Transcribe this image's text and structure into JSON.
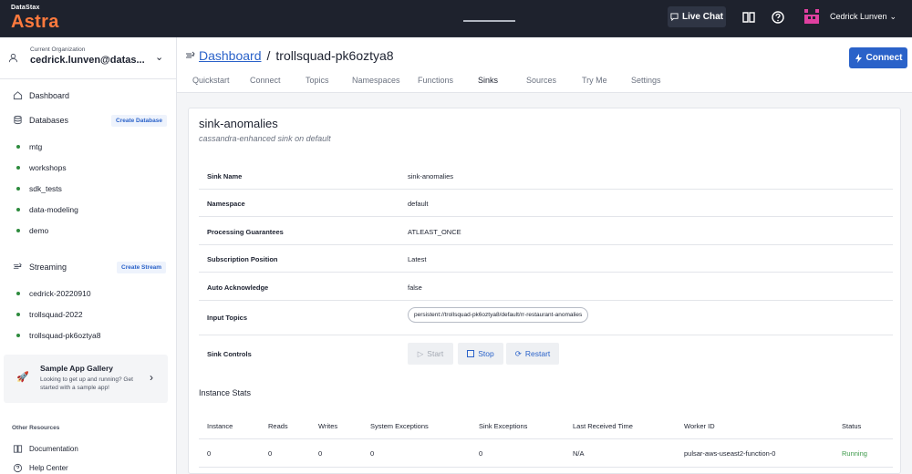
{
  "topbar": {
    "logo_small": "DataStax",
    "logo_big": "Astra",
    "live_chat": "Live Chat",
    "user_name": "Cedrick Lunven",
    "accent_color": "#ff7a3d"
  },
  "sidebar": {
    "org_label": "Current Organization",
    "org_value": "cedrick.lunven@datas...",
    "dashboard": "Dashboard",
    "databases": "Databases",
    "create_database": "Create Database",
    "database_items": [
      "mtg",
      "workshops",
      "sdk_tests",
      "data-modeling",
      "demo"
    ],
    "streaming": "Streaming",
    "create_stream": "Create Stream",
    "stream_items": [
      "cedrick-20220910",
      "trollsquad-2022",
      "trollsquad-pk6oztya8"
    ],
    "gallery_title": "Sample App Gallery",
    "gallery_text": "Looking to get up and running? Get started with a sample app!",
    "other_resources": "Other Resources",
    "documentation": "Documentation",
    "help_center": "Help Center"
  },
  "header": {
    "breadcrumb_link": "Dashboard",
    "separator": "/",
    "current": "trollsquad-pk6oztya8",
    "connect": "Connect"
  },
  "tabs": [
    "Quickstart",
    "Connect",
    "Topics",
    "Namespaces",
    "Functions",
    "Sinks",
    "Sources",
    "Try Me",
    "Settings"
  ],
  "active_tab": "Sinks",
  "sink": {
    "name": "sink-anomalies",
    "subtitle": "cassandra-enhanced sink on default",
    "details": [
      {
        "key": "Sink Name",
        "value": "sink-anomalies"
      },
      {
        "key": "Namespace",
        "value": "default"
      },
      {
        "key": "Processing Guarantees",
        "value": "ATLEAST_ONCE"
      },
      {
        "key": "Subscription Position",
        "value": "Latest"
      },
      {
        "key": "Auto Acknowledge",
        "value": "false"
      }
    ],
    "input_topics_label": "Input Topics",
    "input_topic": "persistent://trollsquad-pk6oztya8/default/rr-restaurant-anomalies",
    "controls_label": "Sink Controls",
    "start": "Start",
    "stop": "Stop",
    "restart": "Restart"
  },
  "stats": {
    "title": "Instance Stats",
    "headers": [
      "Instance",
      "Reads",
      "Writes",
      "System Exceptions",
      "Sink Exceptions",
      "Last Received Time",
      "Worker ID",
      "Status"
    ],
    "row": [
      "0",
      "0",
      "0",
      "0",
      "0",
      "N/A",
      "pulsar-aws-useast2-function-0",
      "Running"
    ],
    "running_color": "#3d9a4a"
  }
}
